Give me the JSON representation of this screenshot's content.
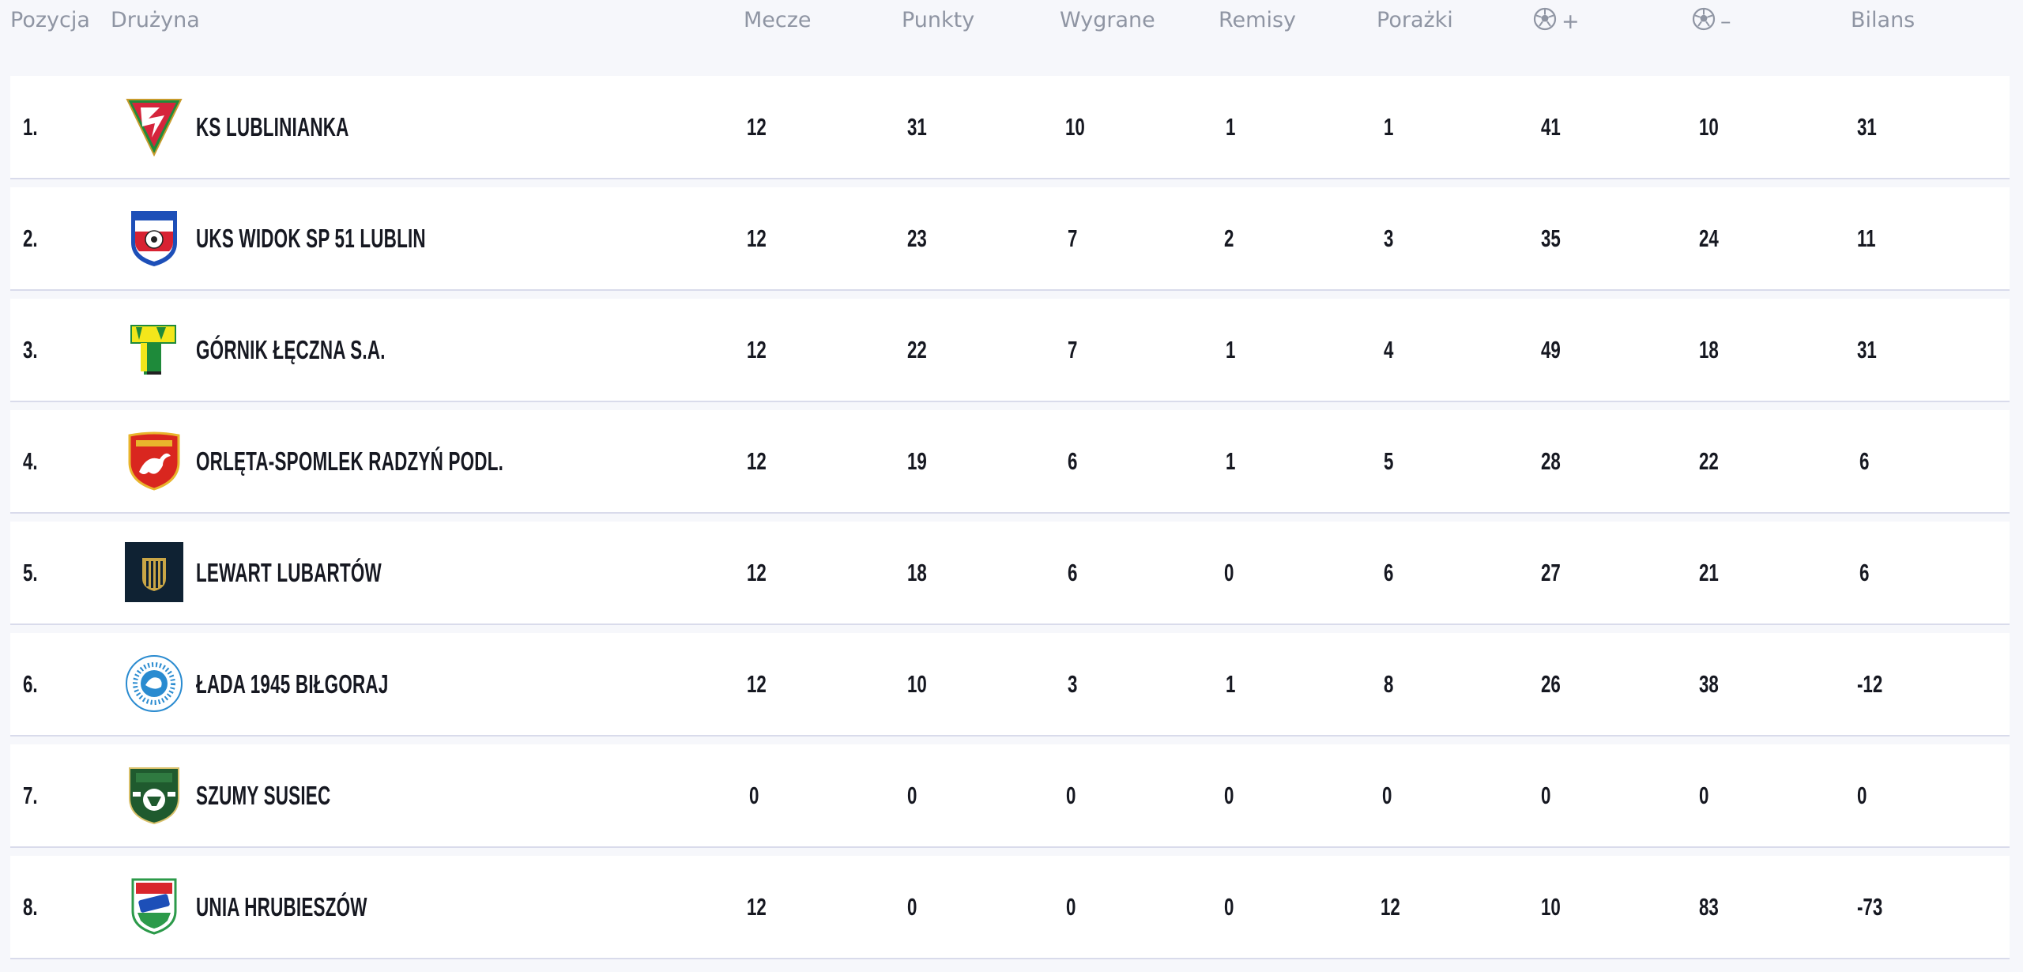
{
  "table": {
    "headers": {
      "position": "Pozycja",
      "team": "Drużyna",
      "matches": "Mecze",
      "points": "Punkty",
      "wins": "Wygrane",
      "draws": "Remisy",
      "losses": "Porażki",
      "goals_for_icon": "soccer-ball-icon",
      "goals_for_sign": "+",
      "goals_against_icon": "soccer-ball-icon",
      "goals_against_sign": "–",
      "balance": "Bilans"
    },
    "rows": [
      {
        "position": "1.",
        "team": "KS LUBLINIANKA",
        "crest_icon": "ks-lublinianka-crest",
        "matches": "12",
        "points": "31",
        "wins": "10",
        "draws": "1",
        "losses": "1",
        "goals_for": "41",
        "goals_against": "10",
        "balance": "31"
      },
      {
        "position": "2.",
        "team": "UKS WIDOK SP 51 LUBLIN",
        "crest_icon": "uks-widok-crest",
        "matches": "12",
        "points": "23",
        "wins": "7",
        "draws": "2",
        "losses": "3",
        "goals_for": "35",
        "goals_against": "24",
        "balance": "11"
      },
      {
        "position": "3.",
        "team": "GÓRNIK ŁĘCZNA S.A.",
        "crest_icon": "gornik-leczna-crest",
        "matches": "12",
        "points": "22",
        "wins": "7",
        "draws": "1",
        "losses": "4",
        "goals_for": "49",
        "goals_against": "18",
        "balance": "31"
      },
      {
        "position": "4.",
        "team": "ORLĘTA-SPOMLEK RADZYŃ PODL.",
        "crest_icon": "orleta-radzyn-crest",
        "matches": "12",
        "points": "19",
        "wins": "6",
        "draws": "1",
        "losses": "5",
        "goals_for": "28",
        "goals_against": "22",
        "balance": "6"
      },
      {
        "position": "5.",
        "team": "LEWART LUBARTÓW",
        "crest_icon": "lewart-lubartow-crest",
        "matches": "12",
        "points": "18",
        "wins": "6",
        "draws": "0",
        "losses": "6",
        "goals_for": "27",
        "goals_against": "21",
        "balance": "6"
      },
      {
        "position": "6.",
        "team": "ŁADA 1945 BIŁGORAJ",
        "crest_icon": "lada-bilgoraj-crest",
        "matches": "12",
        "points": "10",
        "wins": "3",
        "draws": "1",
        "losses": "8",
        "goals_for": "26",
        "goals_against": "38",
        "balance": "-12"
      },
      {
        "position": "7.",
        "team": "SZUMY SUSIEC",
        "crest_icon": "szumy-susiec-crest",
        "matches": "0",
        "points": "0",
        "wins": "0",
        "draws": "0",
        "losses": "0",
        "goals_for": "0",
        "goals_against": "0",
        "balance": "0"
      },
      {
        "position": "8.",
        "team": "UNIA HRUBIESZÓW",
        "crest_icon": "unia-hrubieszow-crest",
        "matches": "12",
        "points": "0",
        "wins": "0",
        "draws": "0",
        "losses": "12",
        "goals_for": "10",
        "goals_against": "83",
        "balance": "-73"
      }
    ]
  },
  "colors": {
    "background": "#f6f7fb",
    "row_background": "#ffffff",
    "row_divider": "#d9dbeb",
    "header_text": "#8f95a3",
    "body_text": "#161821"
  }
}
